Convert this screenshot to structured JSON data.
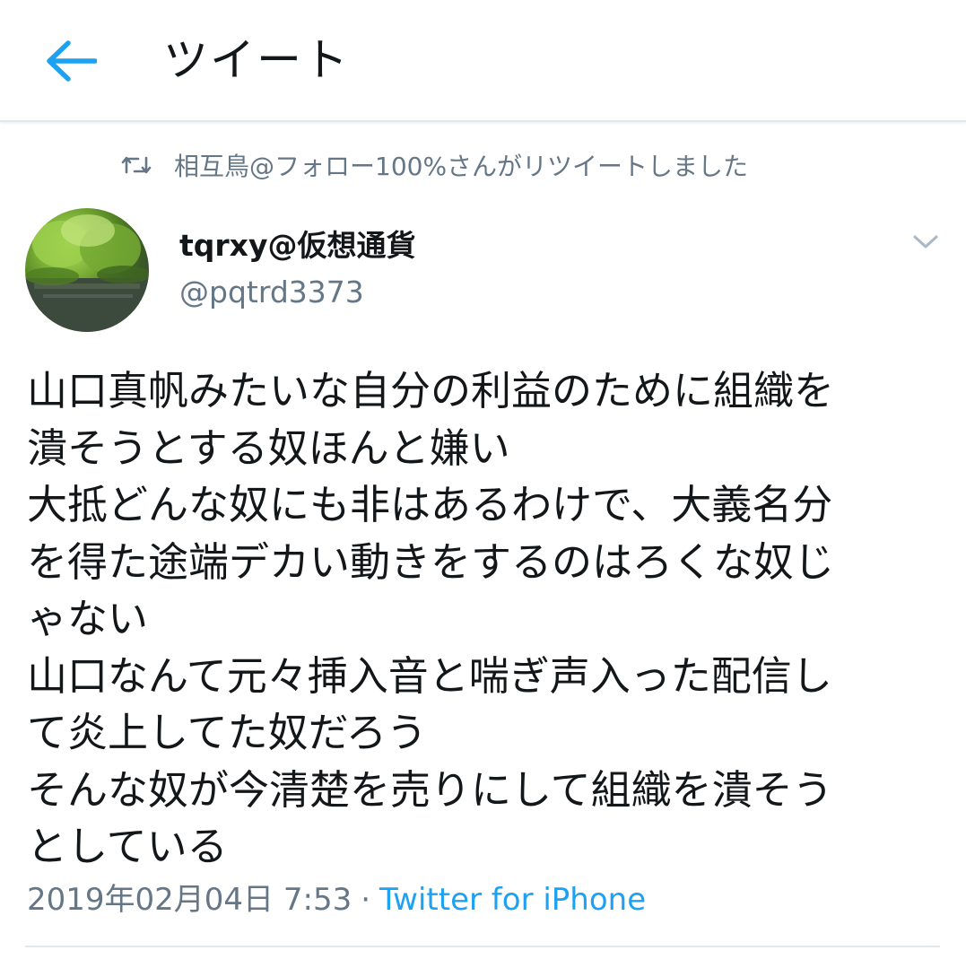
{
  "header": {
    "title": "ツイート",
    "back_icon": "arrow-left-icon",
    "accent": "#1da1f2"
  },
  "retweet": {
    "icon": "retweet-icon",
    "text": "相互鳥@フォロー100%さんがリツイートしました"
  },
  "tweet": {
    "author_name": "tqrxy@仮想通貨",
    "author_handle": "@pqtrd3373",
    "menu_icon": "chevron-down-icon",
    "lines": [
      "山口真帆みたいな自分の利益のために組織を",
      "潰そうとする奴ほんと嫌い",
      "大抵どんな奴にも非はあるわけで、大義名分",
      "を得た途端デカい動きをするのはろくな奴じ",
      "ゃない",
      "山口なんて元々挿入音と喘ぎ声入った配信し",
      "て炎上してた奴だろう",
      "そんな奴が今清楚を売りにして組織を潰そう",
      "としている"
    ],
    "timestamp": "2019年02月04日 7:53",
    "separator": "·",
    "source": "Twitter for iPhone"
  }
}
